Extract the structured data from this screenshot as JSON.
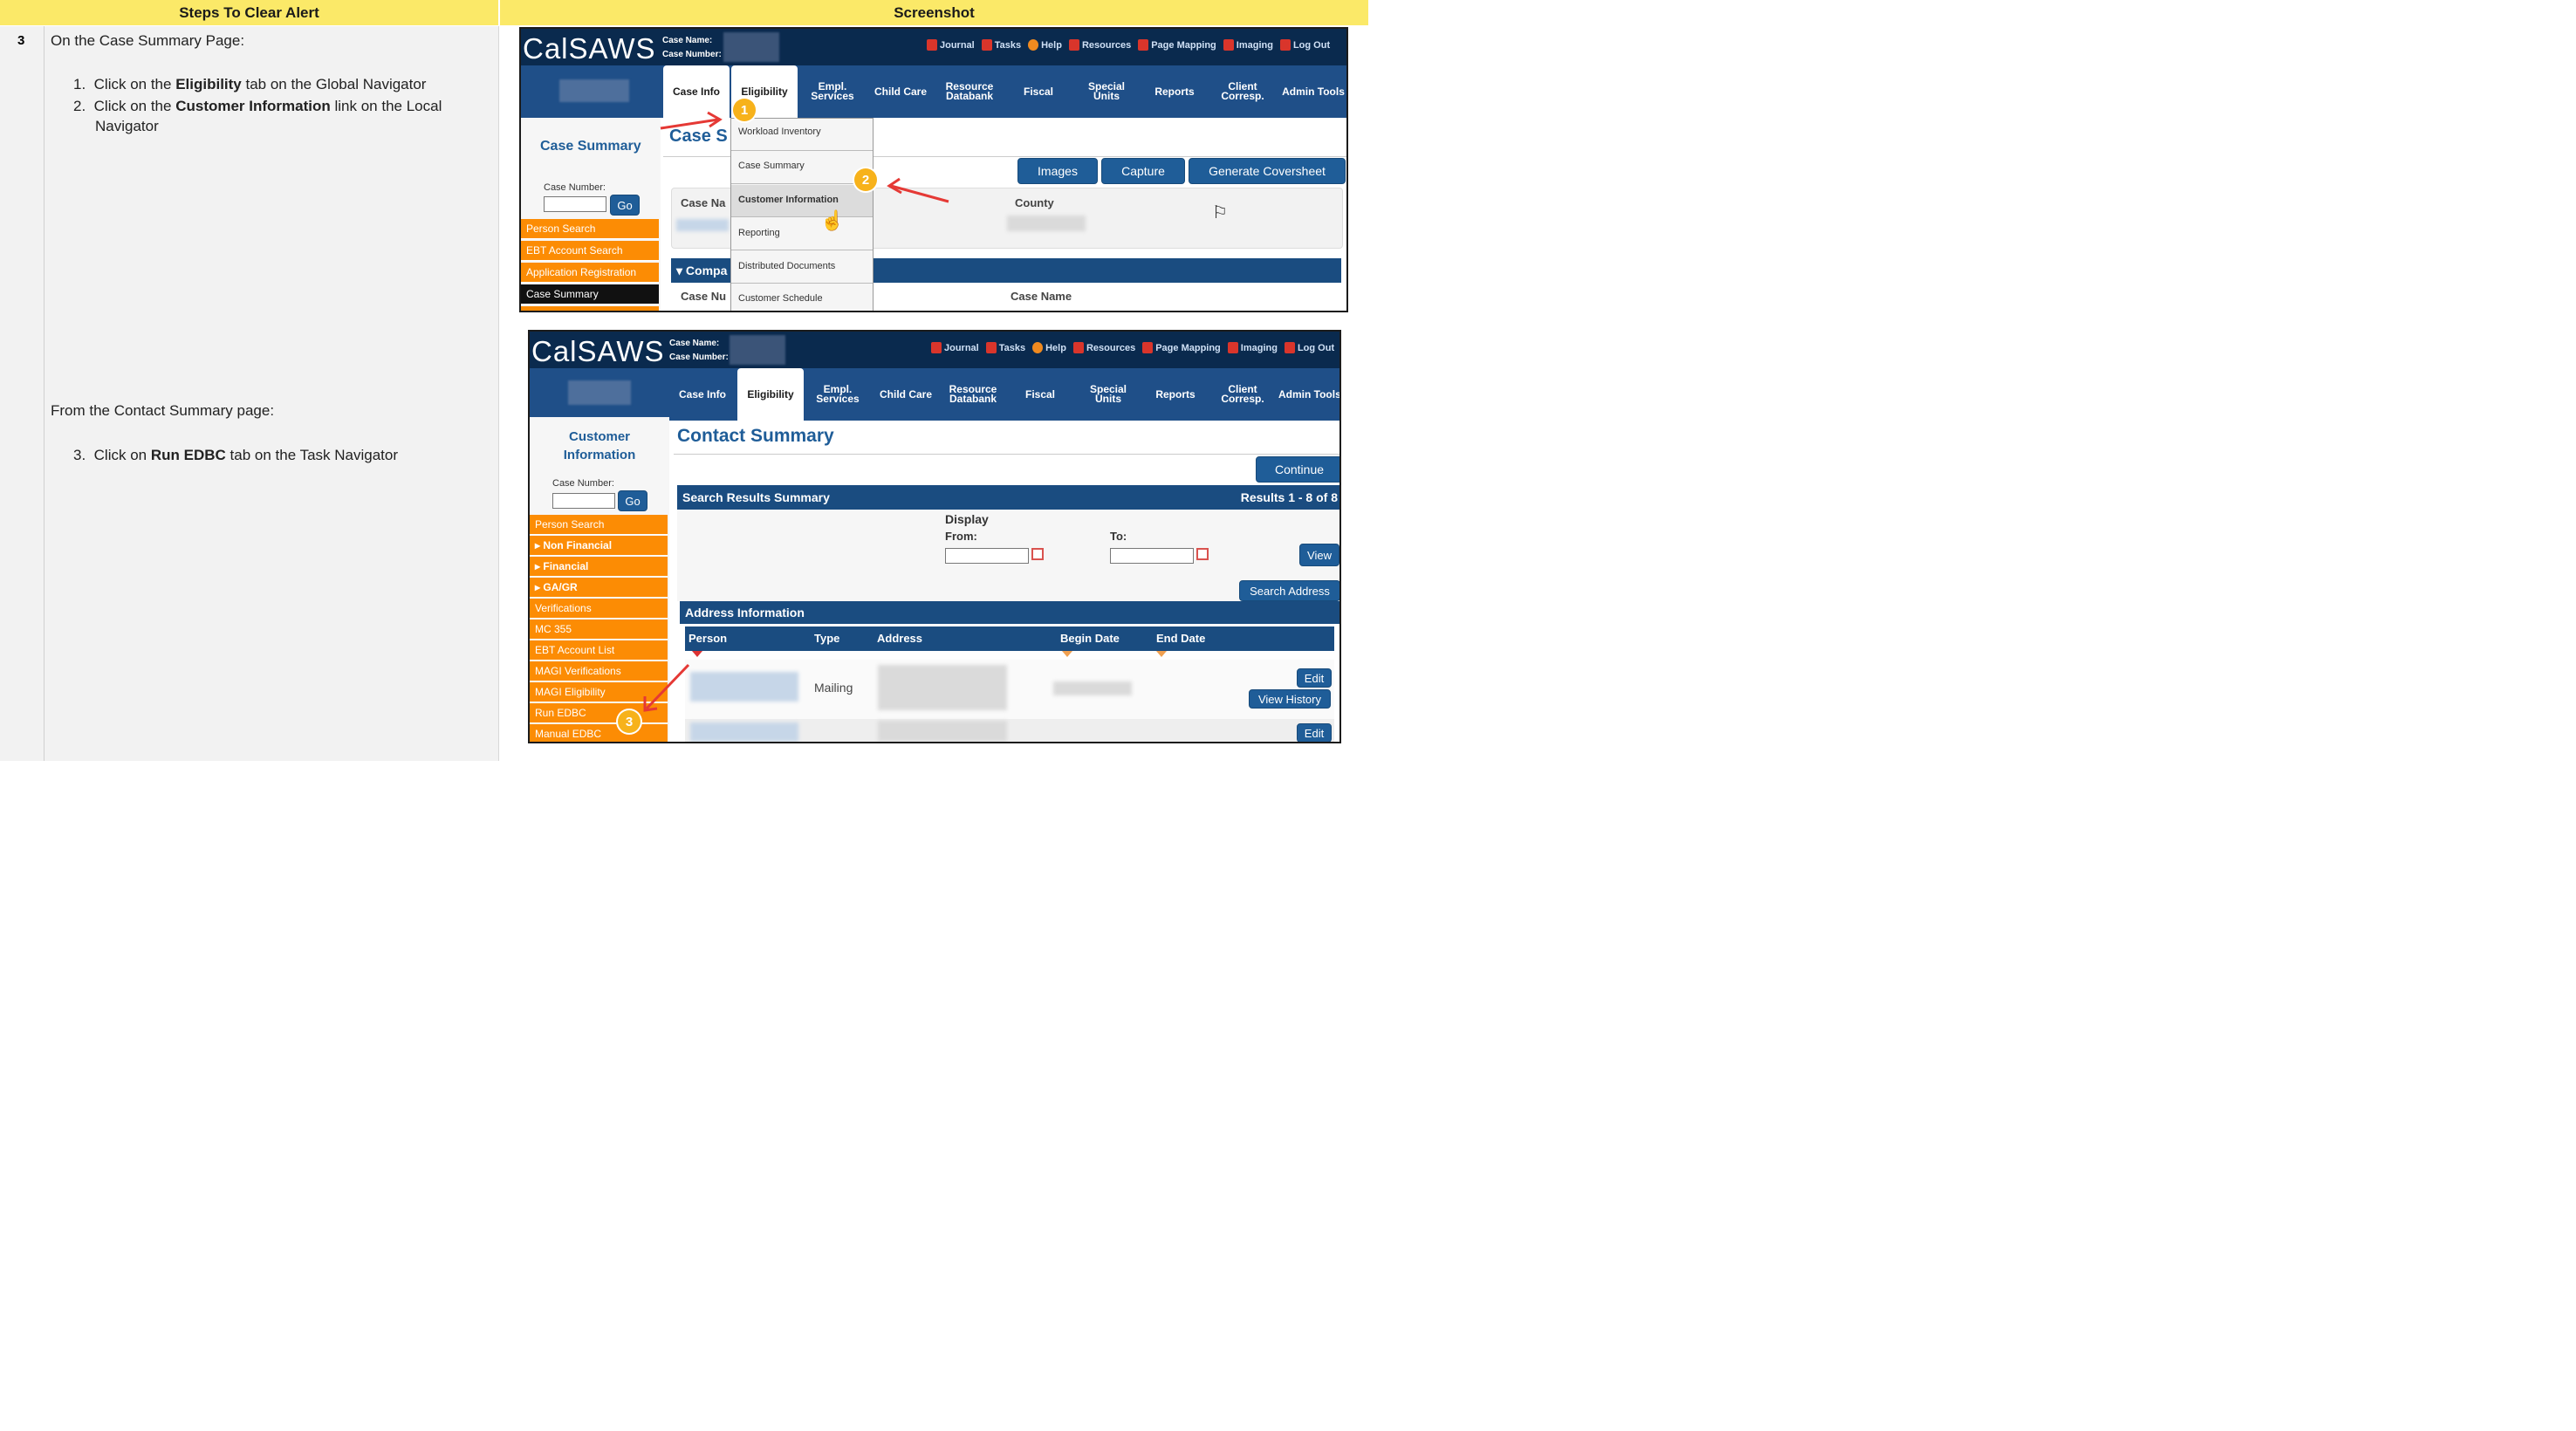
{
  "table": {
    "header_steps": "Steps To Clear Alert",
    "header_screenshot": "Screenshot",
    "step_number": "3",
    "intro1": "On the Case Summary Page:",
    "item1_num": "1.",
    "item1_pre": "Click on the",
    "item1_bold": "Eligibility",
    "item1_post": "tab on the Global Navigator",
    "item2_num": "2.",
    "item2_pre": "Click on the",
    "item2_bold": "Customer Information",
    "item2_post": "link on the Local",
    "item2_post2": "Navigator",
    "intro2": "From the Contact Summary page:",
    "item3_num": "3.",
    "item3_pre": "Click on",
    "item3_bold": "Run EDBC",
    "item3_post": "tab on the Task Navigator"
  },
  "app": {
    "logo": "CalSAWS",
    "case_name_label": "Case Name:",
    "case_number_label": "Case Number:",
    "top_links": [
      "Journal",
      "Tasks",
      "Help",
      "Resources",
      "Page Mapping",
      "Imaging",
      "Log Out"
    ],
    "tabs": [
      "Case Info",
      "Eligibility",
      "Empl. Services",
      "Child Care",
      "Resource Databank",
      "Fiscal",
      "Special Units",
      "Reports",
      "Client Corresp.",
      "Admin Tools"
    ]
  },
  "shot1": {
    "left_title": "Case Summary",
    "case_number_label": "Case Number:",
    "go": "Go",
    "nav_items": [
      "Person Search",
      "EBT Account Search",
      "Application Registration",
      "Case Summary"
    ],
    "page_title_partial": "Case S",
    "dropdown": [
      "Workload Inventory",
      "Case Summary",
      "Customer Information",
      "Reporting",
      "Distributed Documents",
      "Customer Schedule"
    ],
    "buttons": [
      "Images",
      "Capture",
      "Generate Coversheet"
    ],
    "case_name_partial": "Case Na",
    "county_label": "County",
    "band_partial": "Compa",
    "case_nu_partial": "Case Nu",
    "case_name_col": "Case Name",
    "marker1": "1",
    "marker2": "2"
  },
  "shot2": {
    "left_title_line1": "Customer",
    "left_title_line2": "Information",
    "case_number_label": "Case Number:",
    "go": "Go",
    "nav_items": [
      "Person Search",
      "Non Financial",
      "Financial",
      "GA/GR",
      "Verifications",
      "MC 355",
      "EBT Account List",
      "MAGI Verifications",
      "MAGI Eligibility",
      "Run EDBC",
      "Manual EDBC"
    ],
    "page_title": "Contact Summary",
    "continue": "Continue",
    "search_band": "Search Results Summary",
    "results": "Results 1 - 8 of 8",
    "display_label": "Display",
    "from_label": "From:",
    "to_label": "To:",
    "view": "View",
    "search_address": "Search Address",
    "address_band": "Address Information",
    "cols": [
      "Person",
      "Type",
      "Address",
      "Begin Date",
      "End Date"
    ],
    "row1_type": "Mailing",
    "edit": "Edit",
    "view_history": "View History",
    "marker3": "3"
  }
}
